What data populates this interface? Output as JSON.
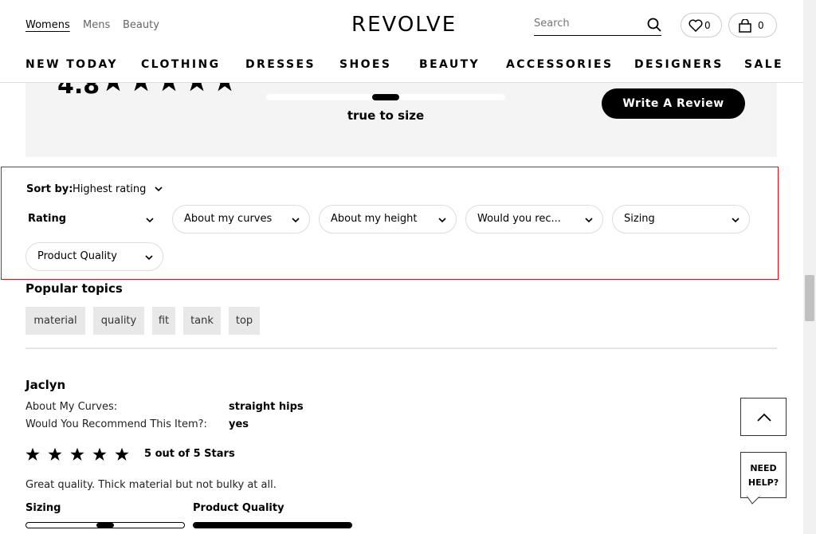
{
  "header": {
    "gender_tabs": [
      {
        "label": "Womens",
        "active": true
      },
      {
        "label": "Mens",
        "active": false
      },
      {
        "label": "Beauty",
        "active": false
      }
    ],
    "logo": "REVOLVE",
    "search": {
      "placeholder": "Search"
    },
    "wishlist_count": "0",
    "cart_count": "0",
    "nav": [
      "NEW TODAY",
      "CLOTHING",
      "DRESSES",
      "SHOES",
      "BEAUTY",
      "ACCESSORIES",
      "DESIGNERS",
      "SALE"
    ]
  },
  "summary": {
    "score": "4.8",
    "fit_label": "true to size",
    "fit_position": 0.5,
    "write_review_label": "Write A Review"
  },
  "filters": {
    "sort_label": "Sort by:",
    "sort_value": "Highest rating",
    "chips": [
      "Rating",
      "About my curves",
      "About my height",
      "Would you rec...",
      "Sizing",
      "Product Quality"
    ]
  },
  "topics": {
    "title": "Popular topics",
    "items": [
      "material",
      "quality",
      "fit",
      "tank",
      "top"
    ]
  },
  "review": {
    "name": "Jaclyn",
    "attributes": [
      {
        "label": "About My Curves:",
        "value": "straight hips"
      },
      {
        "label": "Would You Recommend This Item?:",
        "value": "yes"
      }
    ],
    "rating": 5,
    "rating_text": "5 out of 5 Stars",
    "body": "Great quality. Thick material but not bulky at all.",
    "sizing_label": "Sizing",
    "sizing_position": 0.5,
    "quality_label": "Product Quality",
    "quality_fill": 1.0
  },
  "floating": {
    "need_help": "NEED HELP?"
  },
  "colors": {
    "accent": "#000000",
    "filter_outline": "#d6121d",
    "chip_border": "#dddddd"
  }
}
